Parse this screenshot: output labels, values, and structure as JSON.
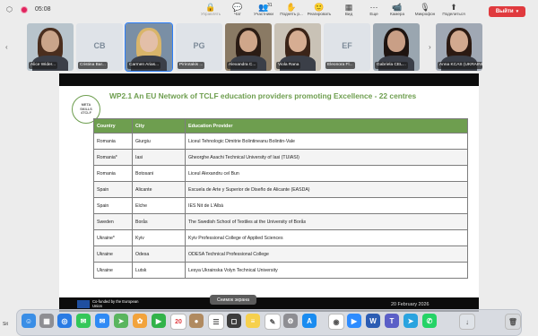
{
  "topbar": {
    "timer": "05:08",
    "tools": [
      {
        "label": "Управлять",
        "glyph": "🔒",
        "disabled": true
      },
      {
        "label": "Чат",
        "glyph": "💬",
        "disabled": false
      },
      {
        "label": "Участники",
        "glyph": "👥",
        "disabled": false,
        "badge": "31"
      },
      {
        "label": "Поднять р...",
        "glyph": "✋",
        "disabled": false
      },
      {
        "label": "Реагировать",
        "glyph": "🙂",
        "disabled": false
      },
      {
        "label": "Вид",
        "glyph": "▦",
        "disabled": false
      },
      {
        "label": "Еще",
        "glyph": "⋯",
        "disabled": false
      },
      {
        "label": "Камера",
        "glyph": "📹",
        "disabled": false
      },
      {
        "label": "Микрофон",
        "glyph": "🎙",
        "disabled": false
      },
      {
        "label": "Поделиться",
        "glyph": "⬆",
        "disabled": false
      }
    ],
    "leave_label": "Выйти"
  },
  "participants": [
    {
      "name": "Alice Wider...",
      "initials": "",
      "photo": true,
      "skin": "#caa58a",
      "hair": "#4a2e1e",
      "bg": "#b8c4cc"
    },
    {
      "name": "Cristina Bar...",
      "initials": "CB",
      "photo": false
    },
    {
      "name": "Carmen Arias...",
      "initials": "",
      "photo": true,
      "skin": "#e3bfa8",
      "hair": "#d9b56a",
      "bg": "#7a8fa5",
      "selected": true
    },
    {
      "name": "Pirirotakis ...",
      "initials": "PG",
      "photo": false
    },
    {
      "name": "Alexandra C...",
      "initials": "",
      "photo": true,
      "skin": "#cfa68a",
      "hair": "#2b1c14",
      "bg": "#8a7a64"
    },
    {
      "name": "Viola Rana",
      "initials": "",
      "photo": true,
      "skin": "#d6ad92",
      "hair": "#3b2418",
      "bg": "#c9c2b6"
    },
    {
      "name": "Eleonora Fl...",
      "initials": "EF",
      "photo": false
    },
    {
      "name": "Gabriela CEL...",
      "initials": "",
      "photo": true,
      "skin": "#c99f86",
      "hair": "#1e1410",
      "bg": "#9aa6b0"
    },
    {
      "name": "Anna KCAS (UKRAINE)",
      "initials": "",
      "photo": true,
      "skin": "#d2a98f",
      "hair": "#2c1a12",
      "bg": "#a0a8b4"
    }
  ],
  "slide": {
    "title": "WP2.1 An EU Network of TCLF education providers promoting Excellence - 22 centres",
    "logo_lines": [
      "META",
      "SKILLS",
      "4TCLF"
    ],
    "columns": [
      "Country",
      "City",
      "Education Provider"
    ],
    "rows": [
      [
        "Romania",
        "Giurgiu",
        "Liceul Tehnologic Dimitrie Bolintineanu Bolintin-Vale"
      ],
      [
        "Romania*",
        "Iasi",
        "Gheorghe Asachi Technical University of Iasi (TUIASI)"
      ],
      [
        "Romania",
        "Botosani",
        "Liceul Alexandru cel Bun"
      ],
      [
        "Spain",
        "Alicante",
        "Escuela de Arte y Superior de Diseño de Alicante (EASDA)"
      ],
      [
        "Spain",
        "Elche",
        "IES Nit de L'Albà"
      ],
      [
        "Sweden",
        "Borås",
        "The Swedish School of Textiles at the University of Borås"
      ],
      [
        "Ukraine*",
        "Kyiv",
        "Kyiv Professional College of Applied Sciences"
      ],
      [
        "Ukraine",
        "Odesa",
        "ODESA Technical Professional College"
      ],
      [
        "Ukraine",
        "Lutsk",
        "Lesya Ukrainska Volyn Technical University"
      ]
    ],
    "footer_cofunded": "Co-funded by the European Union",
    "footer_date": "20 February 2026"
  },
  "tooltip": "Снимок экрана",
  "sidebar_label": "Sit",
  "dock": {
    "calendar_day": "20",
    "apps": [
      {
        "name": "finder",
        "color": "#3a8ee6",
        "glyph": "☺"
      },
      {
        "name": "launchpad",
        "color": "#8e8e93",
        "glyph": "▦"
      },
      {
        "name": "safari",
        "color": "#2a7be4",
        "glyph": "◎"
      },
      {
        "name": "messages",
        "color": "#34c759",
        "glyph": "✉"
      },
      {
        "name": "mail",
        "color": "#2f8af5",
        "glyph": "✉"
      },
      {
        "name": "maps",
        "color": "#5ab55e",
        "glyph": "➤"
      },
      {
        "name": "photos",
        "color": "#f2a33c",
        "glyph": "✿"
      },
      {
        "name": "facetime",
        "color": "#32b34a",
        "glyph": "▶"
      },
      {
        "name": "calendar",
        "color": "#ffffff",
        "glyph": "20"
      },
      {
        "name": "contacts",
        "color": "#b08a60",
        "glyph": "●"
      },
      {
        "name": "reminders",
        "color": "#ffffff",
        "glyph": "☰"
      },
      {
        "name": "screenshot",
        "color": "#3c3c3c",
        "glyph": "◻"
      },
      {
        "name": "notes",
        "color": "#f6d04d",
        "glyph": "≡"
      },
      {
        "name": "freeform",
        "color": "#ffffff",
        "glyph": "✎"
      },
      {
        "name": "settings",
        "color": "#8e8e93",
        "glyph": "⚙"
      },
      {
        "name": "appstore",
        "color": "#1a8cf0",
        "glyph": "A"
      },
      {
        "name": "chrome",
        "color": "#ffffff",
        "glyph": "◉"
      },
      {
        "name": "zoom",
        "color": "#2d8cff",
        "glyph": "▶"
      },
      {
        "name": "word",
        "color": "#2b5cb3",
        "glyph": "W"
      },
      {
        "name": "teams",
        "color": "#5b5fc7",
        "glyph": "T"
      },
      {
        "name": "telegram",
        "color": "#2aa3df",
        "glyph": "➤"
      },
      {
        "name": "whatsapp",
        "color": "#25d366",
        "glyph": "✆"
      },
      {
        "name": "downloads",
        "color": "#dfe3e8",
        "glyph": "↓"
      },
      {
        "name": "trash",
        "color": "#d8dadd",
        "glyph": "🗑"
      }
    ]
  }
}
